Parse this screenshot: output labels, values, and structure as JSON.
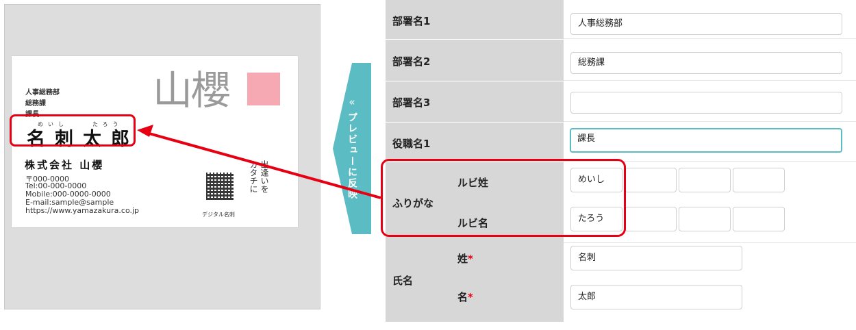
{
  "preview": {
    "card": {
      "dept1": "人事総務部",
      "dept2": "総務課",
      "title": "課長",
      "logo_text": "山櫻",
      "ruby_family": "めいし",
      "ruby_given": "たろう",
      "name": "名刺太郎",
      "company": "株式会社 山櫻",
      "postal": "〒000-0000",
      "tel": "Tel:00-000-0000",
      "mobile": "Mobile:000-0000-0000",
      "email": "E-mail:sample@sample",
      "url": "https://www.yamazakura.co.jp",
      "qr_label": "デジタル名刺",
      "vertical_copy": [
        "出逢いを",
        "カタチに"
      ]
    }
  },
  "preview_tab": {
    "chevron": "«",
    "label": "プレビューに反映"
  },
  "form": {
    "dept1": {
      "label": "部署名1",
      "value": "人事総務部"
    },
    "dept2": {
      "label": "部署名2",
      "value": "総務課"
    },
    "dept3": {
      "label": "部署名3",
      "value": ""
    },
    "title1": {
      "label": "役職名1",
      "value": "課長"
    },
    "furigana": {
      "label": "ふりがな",
      "family_label": "ルビ姓",
      "family_values": [
        "めいし",
        "",
        "",
        ""
      ],
      "given_label": "ルビ名",
      "given_values": [
        "たろう",
        "",
        "",
        ""
      ]
    },
    "fullname": {
      "label": "氏名",
      "family_label": "姓",
      "family_value": "名刺",
      "given_label": "名",
      "given_value": "太郎",
      "required_mark": "*"
    }
  },
  "colors": {
    "accent_teal": "#5bbcc3",
    "highlight_red": "#e60012",
    "logo_pink": "#f6a9b2"
  }
}
